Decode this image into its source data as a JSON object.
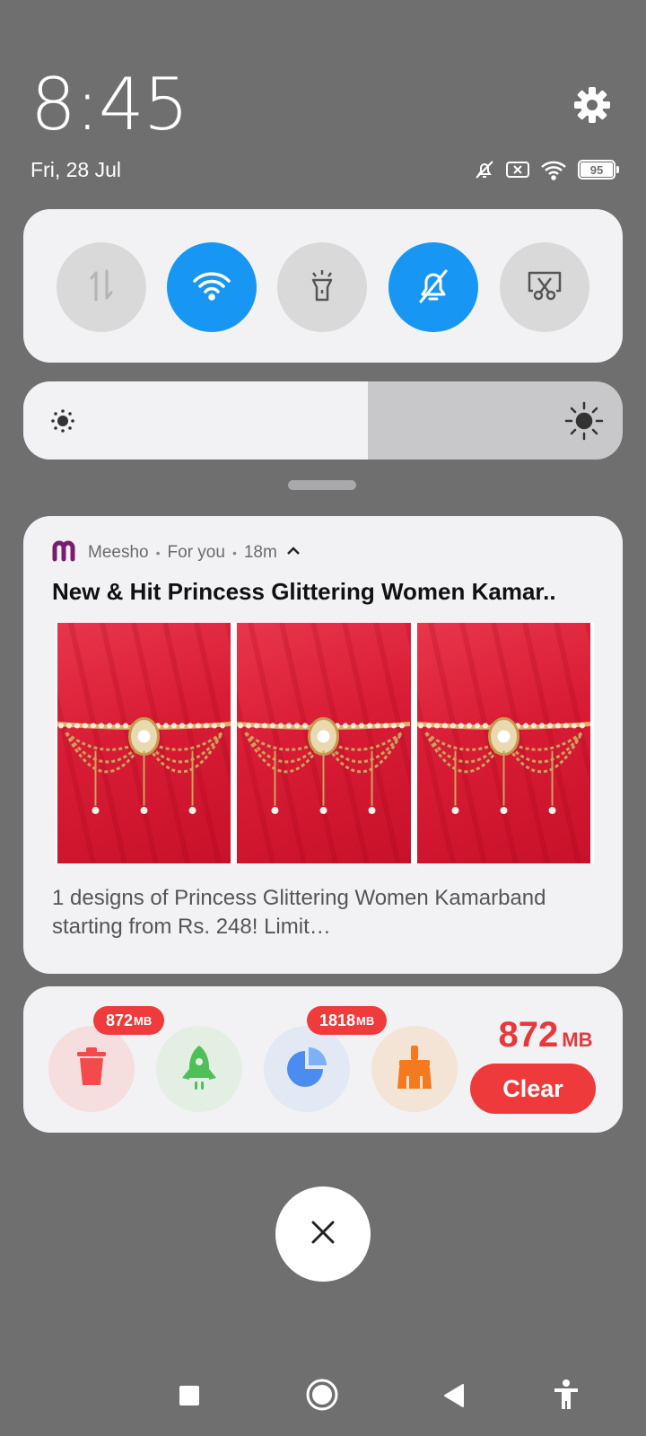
{
  "status": {
    "time": "8:45",
    "date": "Fri, 28 Jul",
    "battery": "95",
    "icons": [
      "settings-icon",
      "silent-icon",
      "no-sim-icon",
      "wifi-icon",
      "battery-icon"
    ]
  },
  "quick_toggles": [
    {
      "name": "mobile-data",
      "icon": "data-arrows-icon",
      "on": false
    },
    {
      "name": "wifi",
      "icon": "wifi-icon",
      "on": true
    },
    {
      "name": "flashlight",
      "icon": "flashlight-icon",
      "on": false
    },
    {
      "name": "silent",
      "icon": "bell-off-icon",
      "on": true
    },
    {
      "name": "screenshot",
      "icon": "scissors-icon",
      "on": false
    }
  ],
  "brightness": {
    "level": 0.575
  },
  "notification": {
    "app": "Meesho",
    "category": "For you",
    "time": "18m",
    "title": "New & Hit Princess Glittering Women Kamar..",
    "body": "1 designs of Princess Glittering Women Kamarband starting from Rs. 248! Limit…",
    "image_count": 3
  },
  "cleaner": {
    "badge1_value": "872",
    "badge1_unit": "MB",
    "badge2_value": "1818",
    "badge2_unit": "MB",
    "junk_value": "872",
    "junk_unit": "MB",
    "clear_label": "Clear",
    "tools": [
      "trash-icon",
      "rocket-icon",
      "pie-chart-icon",
      "broom-icon"
    ]
  },
  "colors": {
    "accent": "#1797f3",
    "danger": "#ef3a3c",
    "background": "#6f6f70",
    "brand": "#7b1d6e"
  }
}
